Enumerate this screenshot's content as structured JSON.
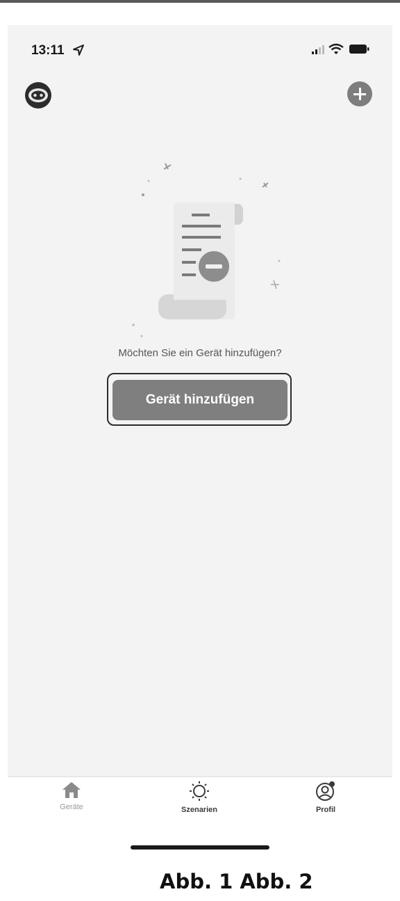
{
  "status_bar": {
    "time": "13:11",
    "icons": [
      "location-arrow-icon",
      "signal-icon",
      "wifi-icon",
      "battery-icon"
    ]
  },
  "header": {
    "avatar_icon": "robot-avatar-icon",
    "add_icon": "plus-circle-icon"
  },
  "empty_state": {
    "illustration": "document-minus-illustration",
    "prompt": "Möchten Sie ein Gerät hinzufügen?",
    "button_label": "Gerät hinzufügen"
  },
  "tab_bar": {
    "tabs": [
      {
        "label": "Geräte",
        "icon": "home-icon",
        "active": false
      },
      {
        "label": "Szenarien",
        "icon": "sun-icon",
        "active": true
      },
      {
        "label": "Profil",
        "icon": "profile-icon",
        "active": true
      }
    ]
  },
  "caption": "Abb. 1 Abb. 2",
  "colors": {
    "background": "#f3f3f3",
    "button": "#7f7f7f",
    "button_text": "#ffffff",
    "inactive_tab": "#9a9a9a"
  }
}
